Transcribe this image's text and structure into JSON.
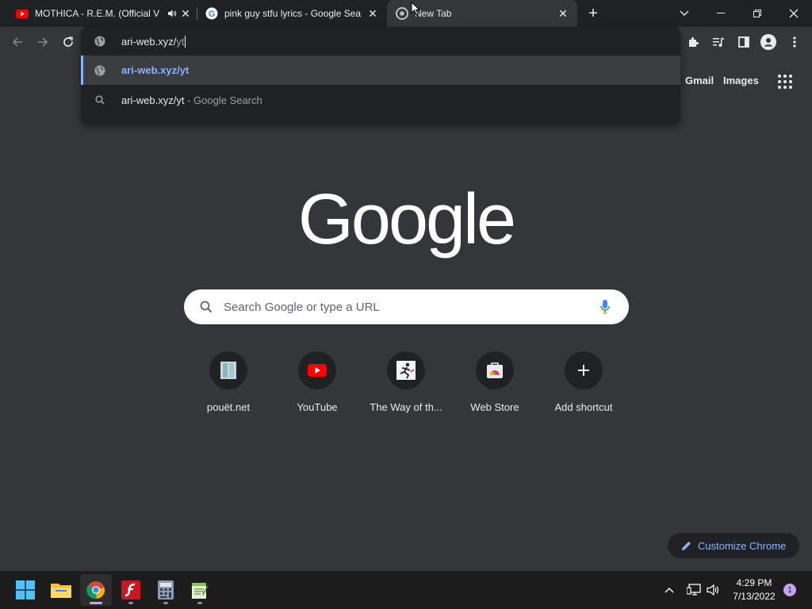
{
  "tabs": [
    {
      "title": "MOTHICA - R.E.M. (Official V",
      "icon": "youtube-icon",
      "audio": "speaker-icon"
    },
    {
      "title": "pink guy stfu lyrics - Google Sear",
      "icon": "google-icon"
    },
    {
      "title": "New Tab",
      "icon": "chrome-icon",
      "active": true
    }
  ],
  "omnibox": {
    "typed": "ari-web.xyz/",
    "autocomplete": "yt",
    "suggestions": [
      {
        "text": "ari-web.xyz/yt",
        "suffix": "",
        "icon": "globe-icon"
      },
      {
        "text": "ari-web.xyz/yt",
        "suffix": " - Google Search",
        "icon": "search-icon"
      }
    ]
  },
  "header_links": {
    "gmail": "Gmail",
    "images": "Images"
  },
  "search": {
    "placeholder": "Search Google or type a URL"
  },
  "logo_text": "Google",
  "shortcuts": [
    {
      "label": "pouët.net",
      "icon": "pouet-icon"
    },
    {
      "label": "YouTube",
      "icon": "youtube-icon"
    },
    {
      "label": "The Way of th...",
      "icon": "runner-icon"
    },
    {
      "label": "Web Store",
      "icon": "webstore-icon"
    },
    {
      "label": "Add shortcut",
      "icon": "plus-icon"
    }
  ],
  "customize": {
    "label": "Customize Chrome"
  },
  "clock": {
    "time": "4:29 PM",
    "date": "7/13/2022"
  },
  "notifications": "1",
  "colors": {
    "accent": "#8ab4f8",
    "background": "#35363a",
    "titlebar": "#202124",
    "taskbar": "#1c1c1c"
  }
}
